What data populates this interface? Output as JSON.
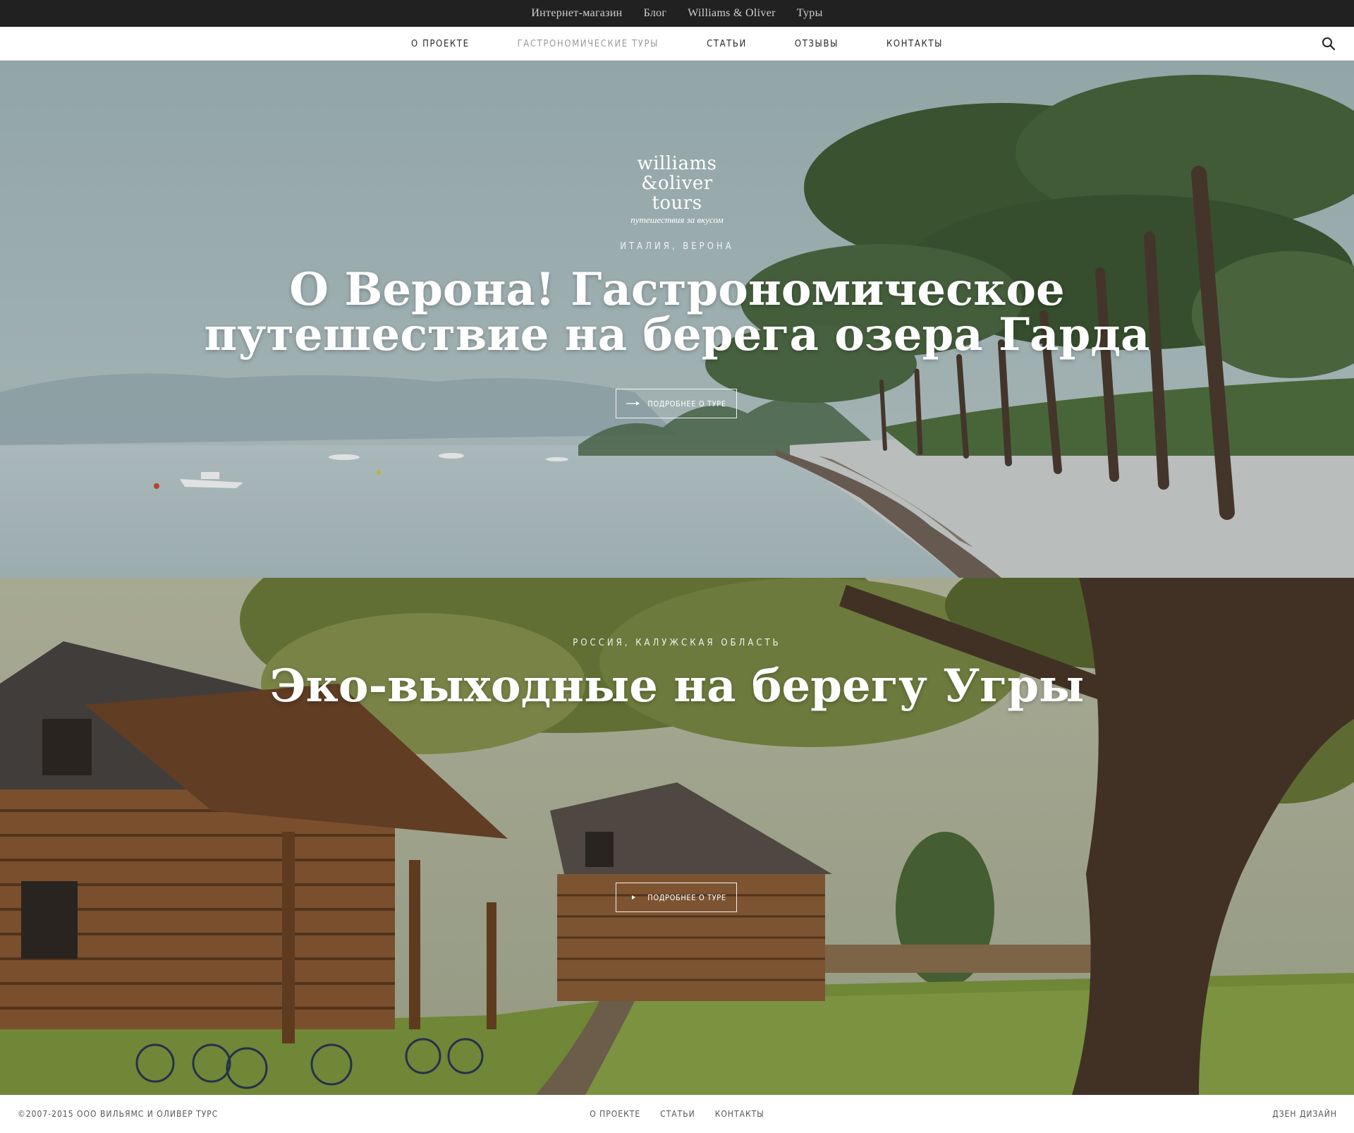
{
  "topbar": {
    "links": [
      "Интернет-магазин",
      "Блог",
      "Williams & Oliver",
      "Туры"
    ]
  },
  "nav": {
    "items": [
      "О ПРОЕКТЕ",
      "ГАСТРОНОМИЧЕСКИЕ ТУРЫ",
      "СТАТЬИ",
      "ОТЗЫВЫ",
      "КОНТАКТЫ"
    ],
    "active_index": 1,
    "search_icon": "search-icon"
  },
  "logo": {
    "line1": "williams",
    "line2": "&oliver",
    "line3": "tours",
    "tagline": "путешествия за вкусом"
  },
  "tours": [
    {
      "location": "ИТАЛИЯ, ВЕРОНА",
      "title_line1": "О Верона! Гастрономическое",
      "title_line2": "путешествие на берега озера Гарда",
      "cta": "ПОДРОБНЕЕ О ТУРЕ"
    },
    {
      "location": "РОССИЯ, КАЛУЖСКАЯ ОБЛАСТЬ",
      "title_line1": "Эко-выходные на берегу Угры",
      "cta": "ПОДРОБНЕЕ О ТУРЕ"
    }
  ],
  "footer": {
    "copyright": "©2007-2015  ООО ВИЛЬЯМС И ОЛИВЕР ТУРС",
    "links": [
      "О ПРОЕКТЕ",
      "СТАТЬИ",
      "КОНТАКТЫ"
    ],
    "credit": "ДЗЕН ДИЗАЙН"
  },
  "colors": {
    "topbar_bg": "#212121",
    "nav_active": "#9a9a9a",
    "nav_text": "#2a2a2a"
  }
}
